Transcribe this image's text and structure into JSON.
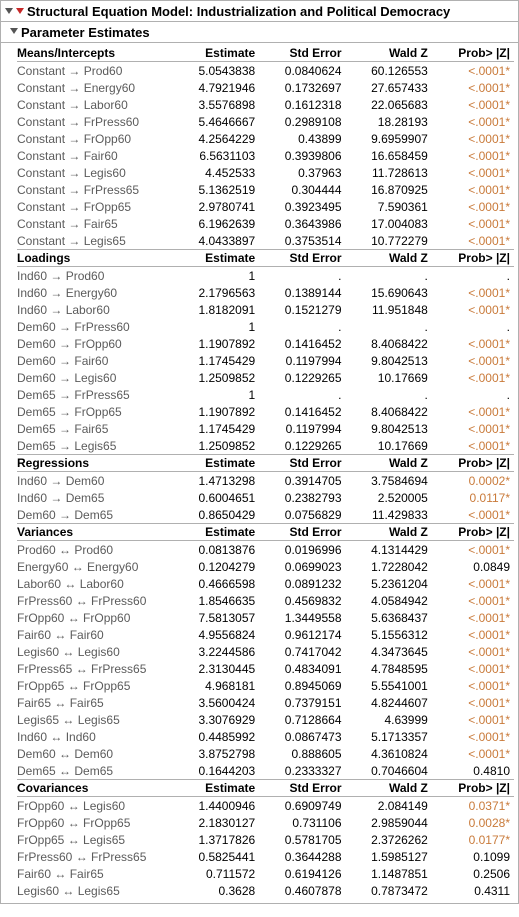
{
  "title": "Structural Equation Model: Industrialization and Political Democracy",
  "subtitle": "Parameter Estimates",
  "arrows": {
    "to": "→",
    "bi": "↔"
  },
  "header_cols": [
    "Estimate",
    "Std Error",
    "Wald Z",
    "Prob> |Z|"
  ],
  "sections": [
    {
      "name": "Means/Intercepts",
      "arrow": "to",
      "rows": [
        {
          "from": "Constant",
          "to": "Prod60",
          "est": "5.0543838",
          "se": "0.0840624",
          "z": "60.126553",
          "p": "<.0001*",
          "sig": true
        },
        {
          "from": "Constant",
          "to": "Energy60",
          "est": "4.7921946",
          "se": "0.1732697",
          "z": "27.657433",
          "p": "<.0001*",
          "sig": true
        },
        {
          "from": "Constant",
          "to": "Labor60",
          "est": "3.5576898",
          "se": "0.1612318",
          "z": "22.065683",
          "p": "<.0001*",
          "sig": true
        },
        {
          "from": "Constant",
          "to": "FrPress60",
          "est": "5.4646667",
          "se": "0.2989108",
          "z": "18.28193",
          "p": "<.0001*",
          "sig": true
        },
        {
          "from": "Constant",
          "to": "FrOpp60",
          "est": "4.2564229",
          "se": "0.43899",
          "z": "9.6959907",
          "p": "<.0001*",
          "sig": true
        },
        {
          "from": "Constant",
          "to": "Fair60",
          "est": "6.5631103",
          "se": "0.3939806",
          "z": "16.658459",
          "p": "<.0001*",
          "sig": true
        },
        {
          "from": "Constant",
          "to": "Legis60",
          "est": "4.452533",
          "se": "0.37963",
          "z": "11.728613",
          "p": "<.0001*",
          "sig": true
        },
        {
          "from": "Constant",
          "to": "FrPress65",
          "est": "5.1362519",
          "se": "0.304444",
          "z": "16.870925",
          "p": "<.0001*",
          "sig": true
        },
        {
          "from": "Constant",
          "to": "FrOpp65",
          "est": "2.9780741",
          "se": "0.3923495",
          "z": "7.590361",
          "p": "<.0001*",
          "sig": true
        },
        {
          "from": "Constant",
          "to": "Fair65",
          "est": "6.1962639",
          "se": "0.3643986",
          "z": "17.004083",
          "p": "<.0001*",
          "sig": true
        },
        {
          "from": "Constant",
          "to": "Legis65",
          "est": "4.0433897",
          "se": "0.3753514",
          "z": "10.772279",
          "p": "<.0001*",
          "sig": true
        }
      ]
    },
    {
      "name": "Loadings",
      "arrow": "to",
      "rows": [
        {
          "from": "Ind60",
          "to": "Prod60",
          "est": "1",
          "se": ".",
          "z": ".",
          "p": ".",
          "sig": false
        },
        {
          "from": "Ind60",
          "to": "Energy60",
          "est": "2.1796563",
          "se": "0.1389144",
          "z": "15.690643",
          "p": "<.0001*",
          "sig": true
        },
        {
          "from": "Ind60",
          "to": "Labor60",
          "est": "1.8182091",
          "se": "0.1521279",
          "z": "11.951848",
          "p": "<.0001*",
          "sig": true
        },
        {
          "from": "Dem60",
          "to": "FrPress60",
          "est": "1",
          "se": ".",
          "z": ".",
          "p": ".",
          "sig": false
        },
        {
          "from": "Dem60",
          "to": "FrOpp60",
          "est": "1.1907892",
          "se": "0.1416452",
          "z": "8.4068422",
          "p": "<.0001*",
          "sig": true
        },
        {
          "from": "Dem60",
          "to": "Fair60",
          "est": "1.1745429",
          "se": "0.1197994",
          "z": "9.8042513",
          "p": "<.0001*",
          "sig": true
        },
        {
          "from": "Dem60",
          "to": "Legis60",
          "est": "1.2509852",
          "se": "0.1229265",
          "z": "10.17669",
          "p": "<.0001*",
          "sig": true
        },
        {
          "from": "Dem65",
          "to": "FrPress65",
          "est": "1",
          "se": ".",
          "z": ".",
          "p": ".",
          "sig": false
        },
        {
          "from": "Dem65",
          "to": "FrOpp65",
          "est": "1.1907892",
          "se": "0.1416452",
          "z": "8.4068422",
          "p": "<.0001*",
          "sig": true
        },
        {
          "from": "Dem65",
          "to": "Fair65",
          "est": "1.1745429",
          "se": "0.1197994",
          "z": "9.8042513",
          "p": "<.0001*",
          "sig": true
        },
        {
          "from": "Dem65",
          "to": "Legis65",
          "est": "1.2509852",
          "se": "0.1229265",
          "z": "10.17669",
          "p": "<.0001*",
          "sig": true
        }
      ]
    },
    {
      "name": "Regressions",
      "arrow": "to",
      "rows": [
        {
          "from": "Ind60",
          "to": "Dem60",
          "est": "1.4713298",
          "se": "0.3914705",
          "z": "3.7584694",
          "p": "0.0002*",
          "sig": true
        },
        {
          "from": "Ind60",
          "to": "Dem65",
          "est": "0.6004651",
          "se": "0.2382793",
          "z": "2.520005",
          "p": "0.0117*",
          "sig": true
        },
        {
          "from": "Dem60",
          "to": "Dem65",
          "est": "0.8650429",
          "se": "0.0756829",
          "z": "11.429833",
          "p": "<.0001*",
          "sig": true
        }
      ]
    },
    {
      "name": "Variances",
      "arrow": "bi",
      "rows": [
        {
          "from": "Prod60",
          "to": "Prod60",
          "est": "0.0813876",
          "se": "0.0196996",
          "z": "4.1314429",
          "p": "<.0001*",
          "sig": true
        },
        {
          "from": "Energy60",
          "to": "Energy60",
          "est": "0.1204279",
          "se": "0.0699023",
          "z": "1.7228042",
          "p": "0.0849",
          "sig": false
        },
        {
          "from": "Labor60",
          "to": "Labor60",
          "est": "0.4666598",
          "se": "0.0891232",
          "z": "5.2361204",
          "p": "<.0001*",
          "sig": true
        },
        {
          "from": "FrPress60",
          "to": "FrPress60",
          "est": "1.8546635",
          "se": "0.4569832",
          "z": "4.0584942",
          "p": "<.0001*",
          "sig": true
        },
        {
          "from": "FrOpp60",
          "to": "FrOpp60",
          "est": "7.5813057",
          "se": "1.3449558",
          "z": "5.6368437",
          "p": "<.0001*",
          "sig": true
        },
        {
          "from": "Fair60",
          "to": "Fair60",
          "est": "4.9556824",
          "se": "0.9612174",
          "z": "5.1556312",
          "p": "<.0001*",
          "sig": true
        },
        {
          "from": "Legis60",
          "to": "Legis60",
          "est": "3.2244586",
          "se": "0.7417042",
          "z": "4.3473645",
          "p": "<.0001*",
          "sig": true
        },
        {
          "from": "FrPress65",
          "to": "FrPress65",
          "est": "2.3130445",
          "se": "0.4834091",
          "z": "4.7848595",
          "p": "<.0001*",
          "sig": true
        },
        {
          "from": "FrOpp65",
          "to": "FrOpp65",
          "est": "4.968181",
          "se": "0.8945069",
          "z": "5.5541001",
          "p": "<.0001*",
          "sig": true
        },
        {
          "from": "Fair65",
          "to": "Fair65",
          "est": "3.5600424",
          "se": "0.7379151",
          "z": "4.8244607",
          "p": "<.0001*",
          "sig": true
        },
        {
          "from": "Legis65",
          "to": "Legis65",
          "est": "3.3076929",
          "se": "0.7128664",
          "z": "4.63999",
          "p": "<.0001*",
          "sig": true
        },
        {
          "from": "Ind60",
          "to": "Ind60",
          "est": "0.4485992",
          "se": "0.0867473",
          "z": "5.1713357",
          "p": "<.0001*",
          "sig": true
        },
        {
          "from": "Dem60",
          "to": "Dem60",
          "est": "3.8752798",
          "se": "0.888605",
          "z": "4.3610824",
          "p": "<.0001*",
          "sig": true
        },
        {
          "from": "Dem65",
          "to": "Dem65",
          "est": "0.1644203",
          "se": "0.2333327",
          "z": "0.7046604",
          "p": "0.4810",
          "sig": false
        }
      ]
    },
    {
      "name": "Covariances",
      "arrow": "bi",
      "rows": [
        {
          "from": "FrOpp60",
          "to": "Legis60",
          "est": "1.4400946",
          "se": "0.6909749",
          "z": "2.084149",
          "p": "0.0371*",
          "sig": true
        },
        {
          "from": "FrOpp60",
          "to": "FrOpp65",
          "est": "2.1830127",
          "se": "0.731106",
          "z": "2.9859044",
          "p": "0.0028*",
          "sig": true
        },
        {
          "from": "FrOpp65",
          "to": "Legis65",
          "est": "1.3717826",
          "se": "0.5781705",
          "z": "2.3726262",
          "p": "0.0177*",
          "sig": true
        },
        {
          "from": "FrPress60",
          "to": "FrPress65",
          "est": "0.5825441",
          "se": "0.3644288",
          "z": "1.5985127",
          "p": "0.1099",
          "sig": false
        },
        {
          "from": "Fair60",
          "to": "Fair65",
          "est": "0.711572",
          "se": "0.6194126",
          "z": "1.1487851",
          "p": "0.2506",
          "sig": false
        },
        {
          "from": "Legis60",
          "to": "Legis65",
          "est": "0.3628",
          "se": "0.4607878",
          "z": "0.7873472",
          "p": "0.4311",
          "sig": false
        }
      ]
    }
  ]
}
